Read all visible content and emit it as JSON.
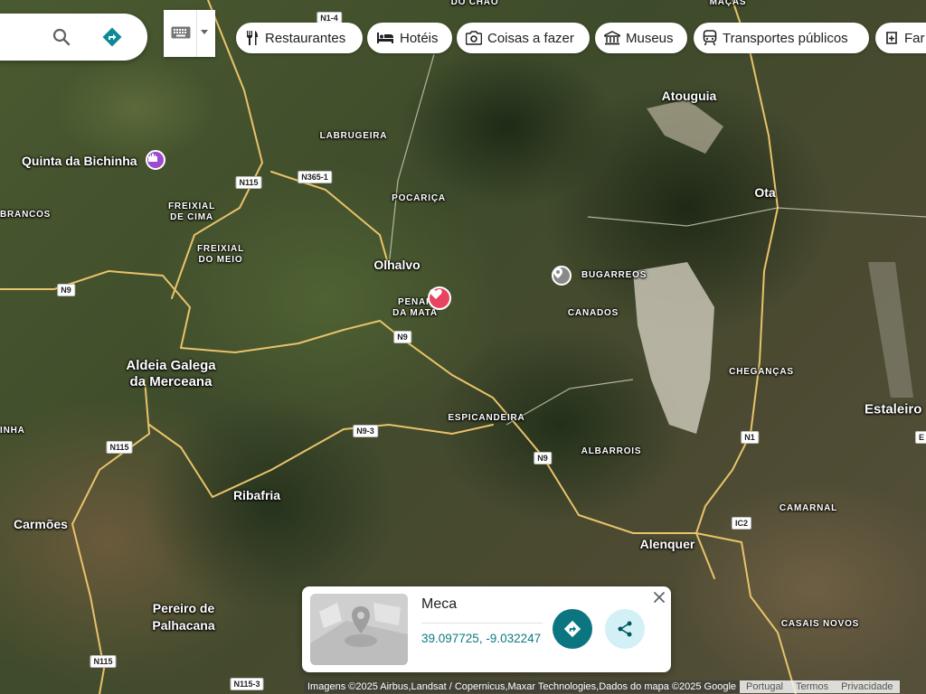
{
  "search": {
    "search_icon": "search-icon",
    "directions_icon": "directions-icon"
  },
  "chips": [
    {
      "label": "Restaurantes",
      "icon": "fork-knife-icon"
    },
    {
      "label": "Hotéis",
      "icon": "bed-icon"
    },
    {
      "label": "Coisas a fazer",
      "icon": "camera-icon"
    },
    {
      "label": "Museus",
      "icon": "museum-icon"
    },
    {
      "label": "Transportes públicos",
      "icon": "train-icon"
    },
    {
      "label": "Far",
      "icon": "pharmacy-icon"
    }
  ],
  "places": {
    "atouguia": "Atouguia",
    "ota": "Ota",
    "quinta": "Quinta da Bichinha",
    "labrugeira": "LABRUGEIRA",
    "pocarica": "POCARIÇA",
    "freixial_cima_1": "FREIXIAL",
    "freixial_cima_2": "DE CIMA",
    "freixial_meio_1": "FREIXIAL",
    "freixial_meio_2": "DO MEIO",
    "brancos": "BRANCOS",
    "olhalvo": "Olhalvo",
    "penafirme_1": "PENAF",
    "penafirme_2": "DA MATA",
    "bugarreos": "BUGARREOS",
    "canados": "CANADOS",
    "aldeia_1": "Aldeia Galega",
    "aldeia_2": "da Merceana",
    "chegancas": "CHEGANÇAS",
    "estaleiro": "Estaleiro",
    "espicandeira": "ESPICANDEIRA",
    "albarrois": "ALBARROIS",
    "inha": "INHA",
    "ribafria": "Ribafria",
    "carmoes": "Carmões",
    "alenquer": "Alenquer",
    "camarnal": "CAMARNAL",
    "pereiro_1": "Pereiro de",
    "pereiro_2": "Palhacana",
    "casais_novos": "CASAIS NOVOS",
    "do_chao": "DO CHÃO",
    "macas": "MAÇÃS"
  },
  "roads": {
    "n1_4": "N1-4",
    "n115_a": "N115",
    "n365_1": "N365-1",
    "n9_a": "N9",
    "n9_b": "N9",
    "n9_3": "N9-3",
    "n115_b": "N115",
    "n9_c": "N9",
    "n1": "N1",
    "ic2": "IC2",
    "n115_c": "N115",
    "n115_3": "N115-3",
    "e_label": "E"
  },
  "card": {
    "title": "Meca",
    "coords": "39.097725, -9.032247",
    "directions_icon": "directions-icon",
    "share_icon": "share-icon",
    "close_icon": "close-icon"
  },
  "attribution": {
    "text": "Imagens ©2025 Airbus,Landsat / Copernicus,Maxar Technologies,Dados do mapa ©2025 Google",
    "portugal": "Portugal",
    "termos": "Termos",
    "privacidade": "Privacidade"
  },
  "colors": {
    "pin_red": "#e8445f",
    "poi_purple": "#9c4dcc",
    "teal": "#0b7680"
  }
}
